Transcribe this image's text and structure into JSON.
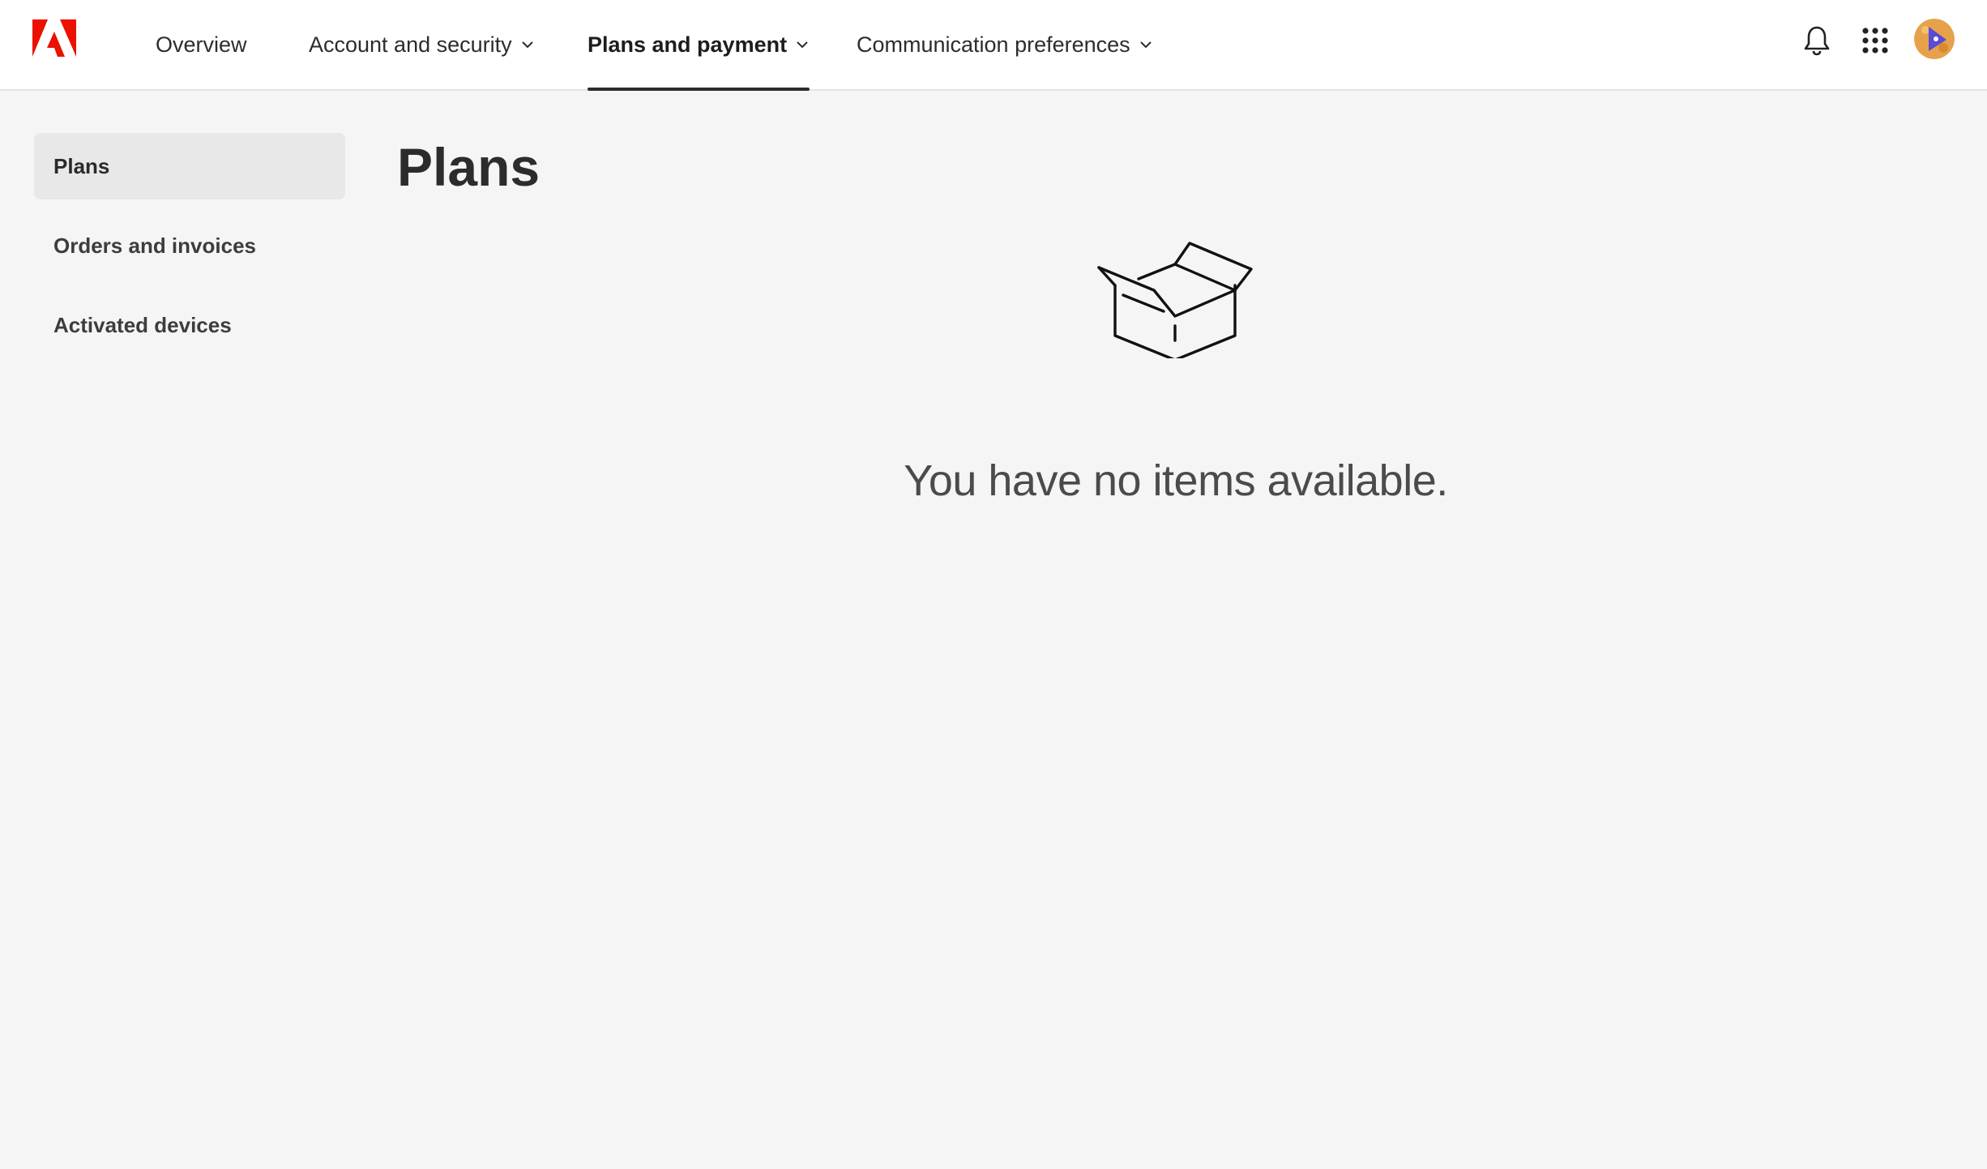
{
  "brand": {
    "name": "Adobe",
    "logo_color": "#eb1000",
    "icon": "adobe-logo-icon"
  },
  "header": {
    "nav": [
      {
        "label": "Overview",
        "has_dropdown": false,
        "active": false
      },
      {
        "label": "Account and security",
        "has_dropdown": true,
        "active": false
      },
      {
        "label": "Plans and payment",
        "has_dropdown": true,
        "active": true
      },
      {
        "label": "Communication preferences",
        "has_dropdown": true,
        "active": false
      }
    ],
    "icons": [
      "bell-icon",
      "apps-grid-icon",
      "avatar"
    ]
  },
  "sidebar": {
    "items": [
      {
        "label": "Plans",
        "active": true
      },
      {
        "label": "Orders and invoices",
        "active": false
      },
      {
        "label": "Activated devices",
        "active": false
      }
    ]
  },
  "main": {
    "title": "Plans",
    "empty_state": {
      "icon": "open-box-icon",
      "message": "You have no items available."
    }
  },
  "colors": {
    "background": "#f5f5f5",
    "header_bg": "#ffffff",
    "active_sidebar_bg": "#e8e8e8",
    "text": "#2c2c2c"
  }
}
